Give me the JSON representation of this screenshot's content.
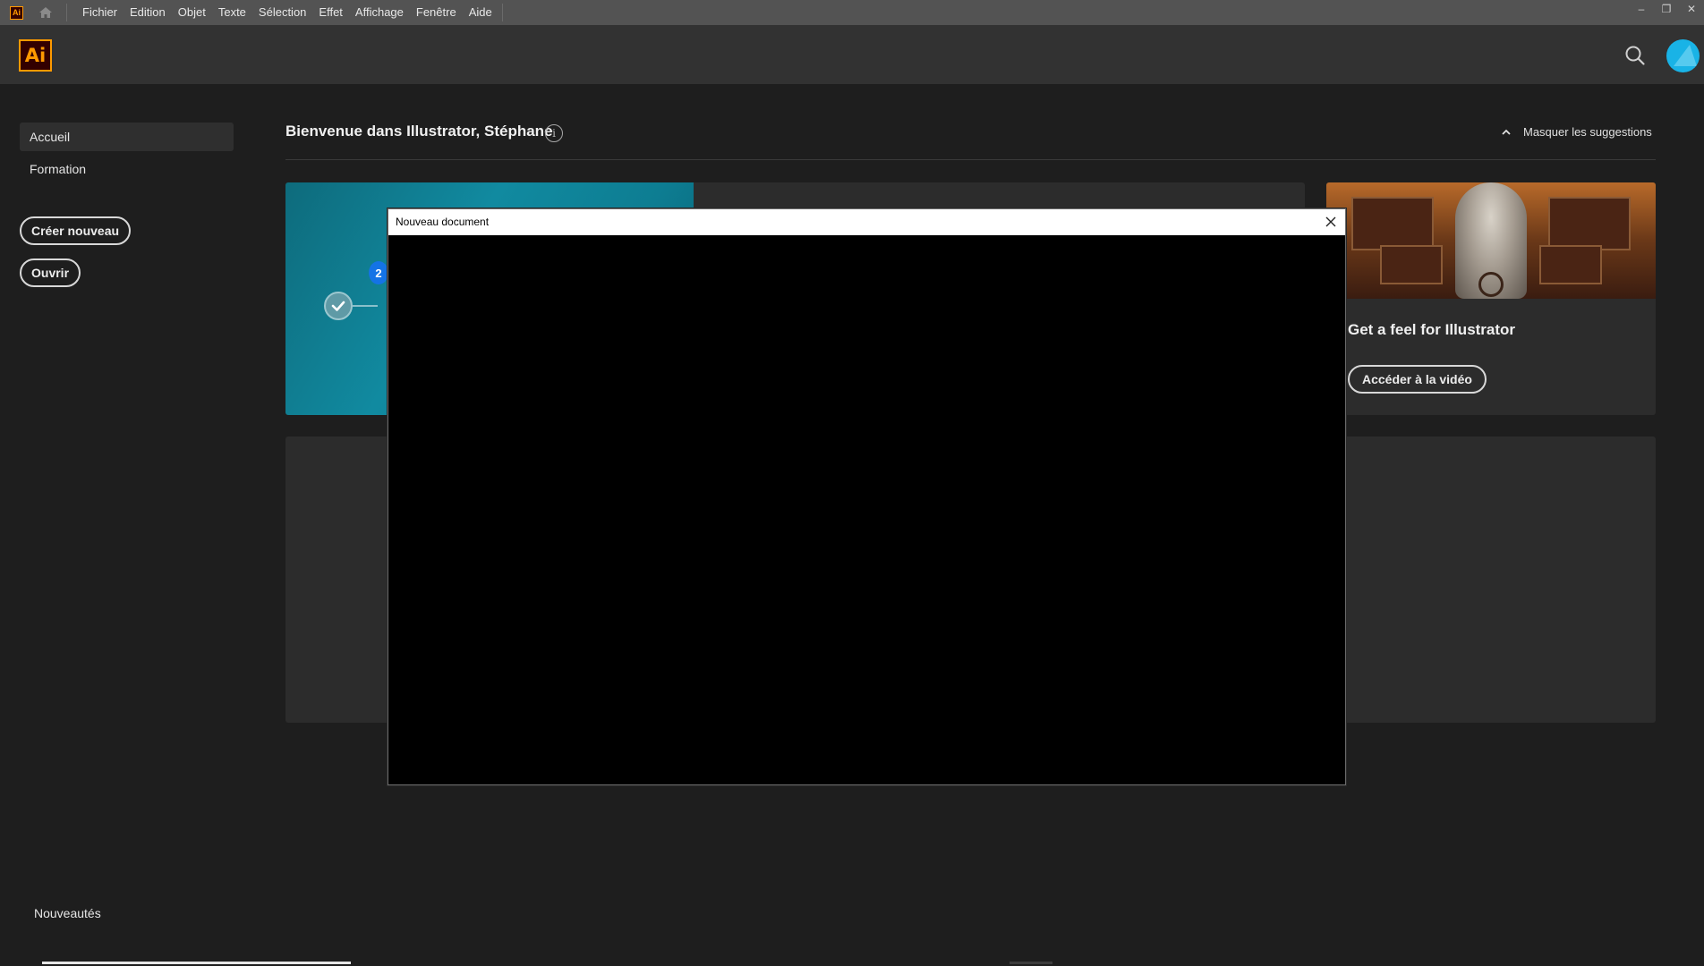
{
  "menubar": {
    "app_badge": "Ai",
    "items": [
      "Fichier",
      "Edition",
      "Objet",
      "Texte",
      "Sélection",
      "Effet",
      "Affichage",
      "Fenêtre",
      "Aide"
    ],
    "window_controls": {
      "minimize": "–",
      "restore": "❐",
      "close": "✕"
    }
  },
  "header": {
    "logo": "Ai",
    "search_icon": "search-icon",
    "avatar_color": "#19b3e6"
  },
  "sidebar": {
    "nav": [
      {
        "label": "Accueil",
        "active": true
      },
      {
        "label": "Formation",
        "active": false
      }
    ],
    "create_new": "Créer nouveau",
    "open": "Ouvrir",
    "whats_new": "Nouveautés"
  },
  "main": {
    "welcome": "Bienvenue dans Illustrator, Stéphane",
    "info_icon": "i",
    "hide_suggestions": "Masquer les suggestions",
    "tutorial_card": {
      "step_number": "2"
    },
    "video_card": {
      "title": "Get a feel for Illustrator",
      "button": "Accéder à la vidéo"
    }
  },
  "modal": {
    "title": "Nouveau document",
    "close_icon": "close-icon"
  },
  "colors": {
    "accent_orange": "#ff9a00",
    "logo_bg": "#330000",
    "app_bg": "#1e1e1e",
    "card_bg": "#2c2c2c",
    "step_blue": "#1473e6"
  }
}
